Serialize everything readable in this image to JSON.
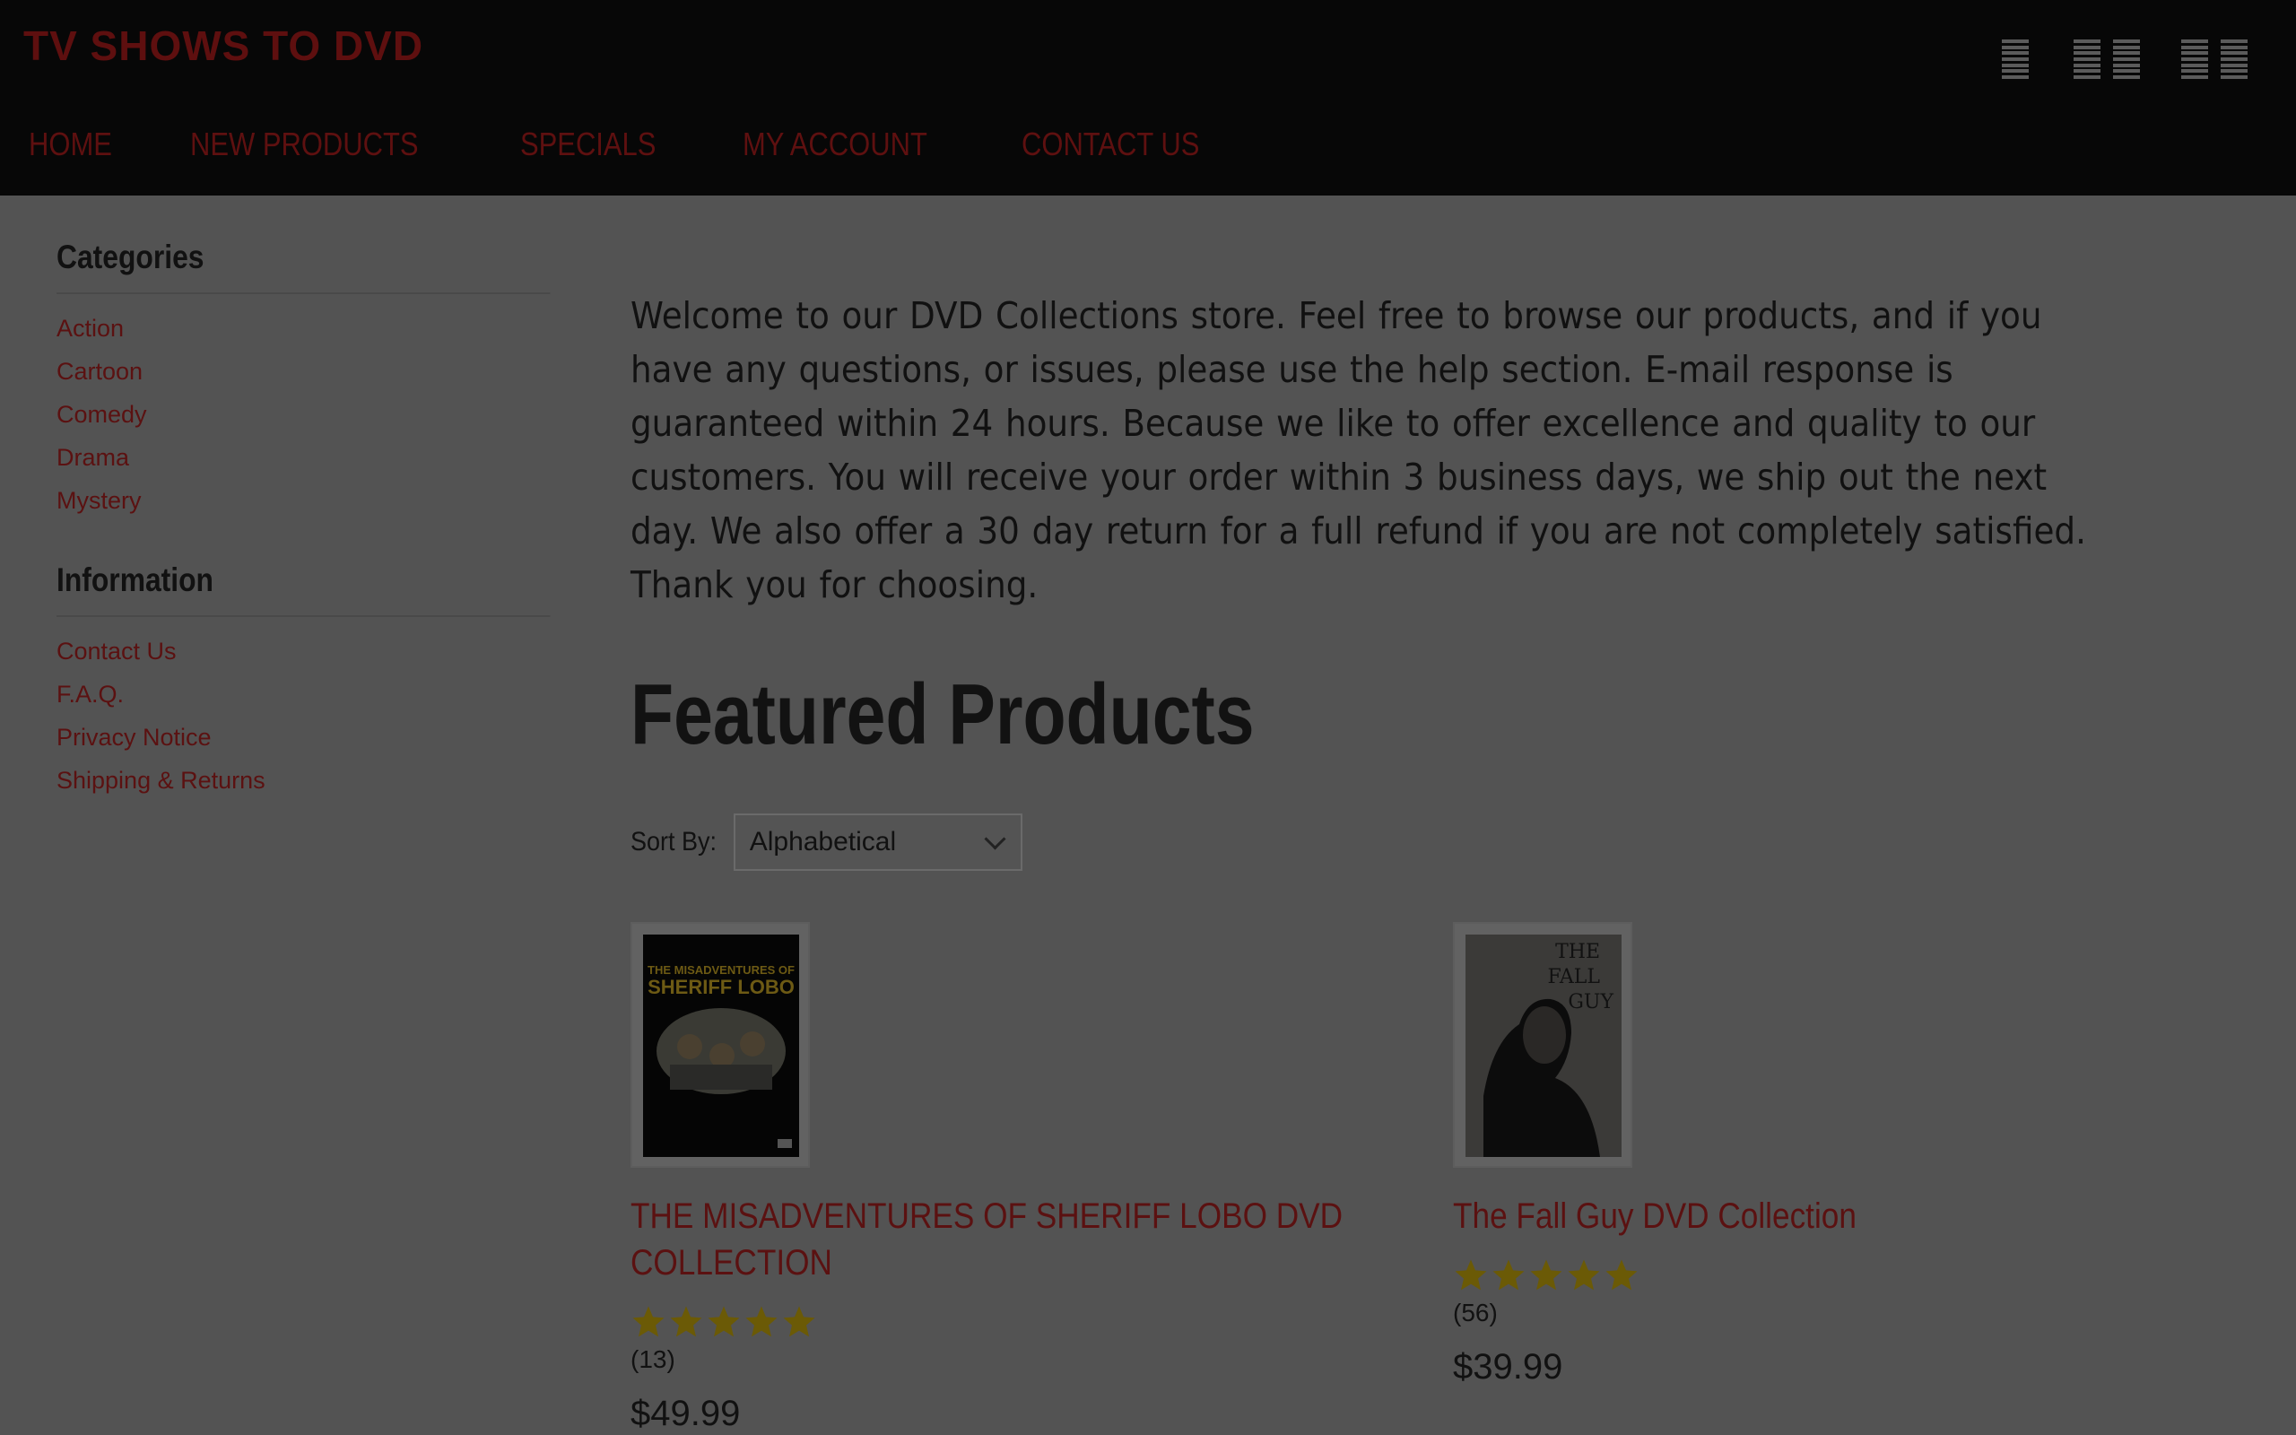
{
  "site": {
    "title": "TV SHOWS TO DVD"
  },
  "nav": {
    "items": [
      {
        "label": "HOME"
      },
      {
        "label": "NEW PRODUCTS"
      },
      {
        "label": "SPECIALS"
      },
      {
        "label": "MY ACCOUNT"
      },
      {
        "label": "CONTACT US"
      }
    ]
  },
  "view_switch": {
    "icons": [
      "list-view-icon",
      "two-column-view-icon",
      "grid-view-icon"
    ]
  },
  "sidebar": {
    "categories": {
      "heading": "Categories",
      "items": [
        {
          "label": "Action"
        },
        {
          "label": "Cartoon"
        },
        {
          "label": "Comedy"
        },
        {
          "label": "Drama"
        },
        {
          "label": "Mystery"
        }
      ]
    },
    "information": {
      "heading": "Information",
      "items": [
        {
          "label": "Contact Us"
        },
        {
          "label": "F.A.Q."
        },
        {
          "label": "Privacy Notice"
        },
        {
          "label": "Shipping & Returns"
        }
      ]
    }
  },
  "main": {
    "welcome": " Welcome to our DVD Collections store. Feel free to browse our products, and if you have any questions, or issues, please use the help section. E-mail response is guaranteed within 24 hours. Because we like to offer excellence and quality to our customers. You will receive your order within 3 business days, we ship out the next day. We also offer a 30 day return for a full refund if you are not completely satisfied.  Thank you for choosing.",
    "featured_heading": "Featured Products",
    "sort": {
      "label": "Sort By:",
      "selected": "Alphabetical"
    }
  },
  "products": [
    {
      "title": "THE MISADVENTURES OF SHERIFF LOBO DVD COLLECTION",
      "cover_text": "THE MISADVENTURES OF SHERIFF LOBO",
      "rating": 5,
      "reviews": "(13)",
      "price": "$49.99"
    },
    {
      "title": "The Fall Guy DVD Collection",
      "cover_text": "THE FALL GUY",
      "rating": 5,
      "reviews": "(56)",
      "price": "$39.99"
    }
  ],
  "colors": {
    "topbar": "#070707",
    "page_bg": "#535353",
    "link": "#5b1111",
    "star": "#6b5a06"
  }
}
